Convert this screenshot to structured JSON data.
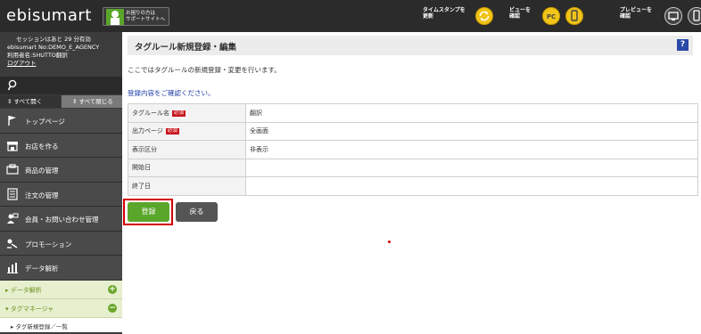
{
  "header": {
    "logo": "ebisumart",
    "support_button": "お困りの方は\nサポートサイトへ",
    "timestamp_label": "タイムスタンプを\n更新",
    "view_label": "ビューを\n確認",
    "view_pc": "PC",
    "preview_label": "プレビューを\n確認"
  },
  "sidebar": {
    "session_line1": "セッションはあと 29 分有効",
    "session_line2": "ebisumart No:DEMO_E_AGENCY",
    "session_line3": "利用者名:SHUTTO翻訳",
    "logout": "ログアウト",
    "expand_all": "すべて開く",
    "collapse_all": "すべて閉じる",
    "menu": [
      {
        "label": "トップページ",
        "icon": "flag-icon"
      },
      {
        "label": "お店を作る",
        "icon": "shop-icon"
      },
      {
        "label": "商品の管理",
        "icon": "product-icon"
      },
      {
        "label": "注文の管理",
        "icon": "order-icon"
      },
      {
        "label": "会員・お問い合わせ管理",
        "icon": "member-icon"
      },
      {
        "label": "プロモーション",
        "icon": "promotion-icon"
      },
      {
        "label": "データ解析",
        "icon": "chart-icon"
      }
    ],
    "sub_items": [
      {
        "label": "データ解析",
        "control": "+"
      },
      {
        "label": "タグマネージャ",
        "control": "−"
      }
    ],
    "sub_sub_item": "タグ新規登録／一覧"
  },
  "main": {
    "title": "タグルール新規登録・編集",
    "help": "?",
    "description": "ここではタグルールの新規登録・変更を行います。",
    "confirm": "登録内容をご確認ください。",
    "required_badge": "必須",
    "rows": [
      {
        "label": "タグルール名",
        "value": "翻訳"
      },
      {
        "label": "出力ページ",
        "value": "全画面"
      },
      {
        "label": "表示区分",
        "value": "非表示"
      },
      {
        "label": "開始日",
        "value": ""
      },
      {
        "label": "終了日",
        "value": ""
      }
    ],
    "register_button": "登録",
    "back_button": "戻る"
  },
  "colors": {
    "header_bg": "#2b2b2b",
    "sidebar_bg": "#4a4a4a",
    "accent_green": "#5aa62a",
    "required_red": "#c8161d",
    "link_blue": "#1f3fa8",
    "highlight_red": "#d20000"
  }
}
